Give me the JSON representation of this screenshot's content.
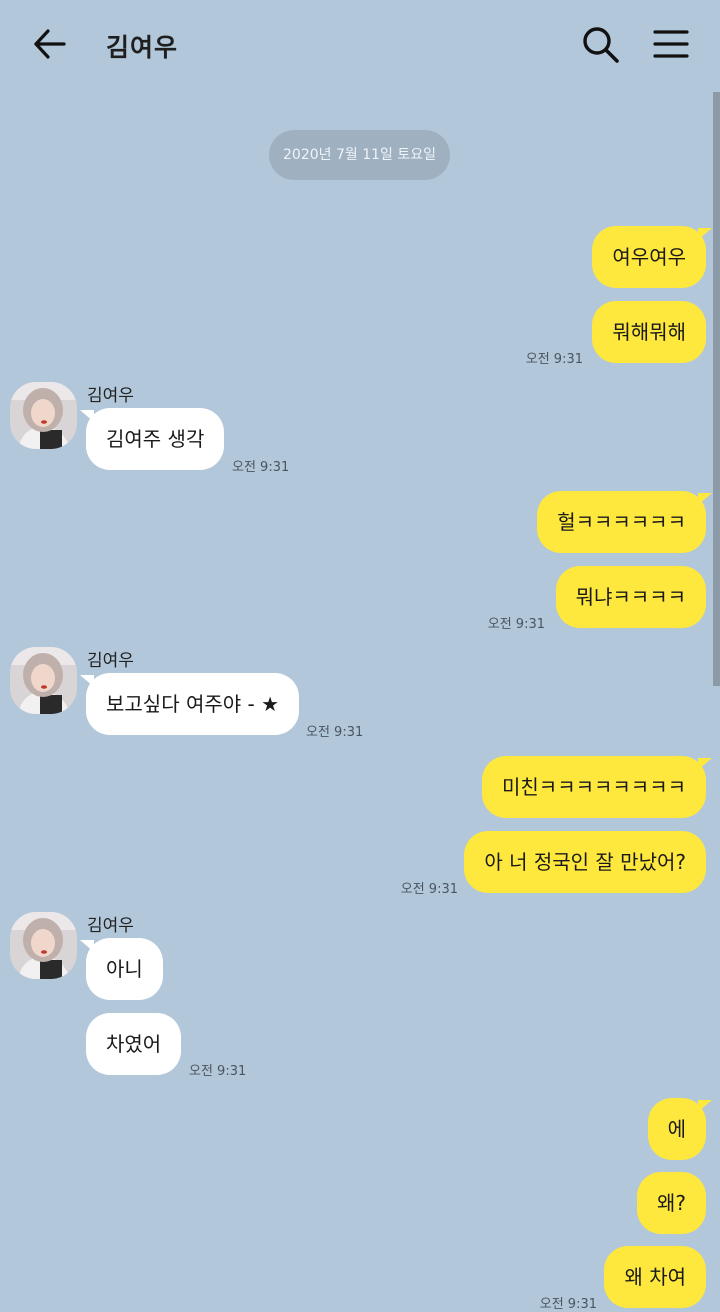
{
  "header": {
    "title": "김여우",
    "back_icon": "arrow-left-icon",
    "search_icon": "search-icon",
    "menu_icon": "hamburger-menu-icon"
  },
  "date_divider": "2020년 7월 11일 토요일",
  "messages": [
    {
      "side": "me",
      "text": "여우여우"
    },
    {
      "side": "me",
      "text": "뭐해뭐해",
      "time": "오전 9:31"
    },
    {
      "side": "them",
      "sender": "김여우",
      "text": "김여주 생각",
      "time": "오전 9:31"
    },
    {
      "side": "me",
      "text": "헐ㅋㅋㅋㅋㅋㅋ"
    },
    {
      "side": "me",
      "text": "뭐냐ㅋㅋㅋㅋ",
      "time": "오전 9:31"
    },
    {
      "side": "them",
      "sender": "김여우",
      "text": "보고싶다 여주야 - ★",
      "time": "오전 9:31"
    },
    {
      "side": "me",
      "text": "미친ㅋㅋㅋㅋㅋㅋㅋㅋ"
    },
    {
      "side": "me",
      "text": "아 너 정국인 잘 만났어?",
      "time": "오전 9:31"
    },
    {
      "side": "them",
      "sender": "김여우",
      "text": "아니"
    },
    {
      "side": "them",
      "text": "차였어",
      "time": "오전 9:31"
    },
    {
      "side": "me",
      "text": "에"
    },
    {
      "side": "me",
      "text": "왜?"
    },
    {
      "side": "me",
      "text": "왜 차여",
      "time": "오전 9:31"
    }
  ],
  "colors": {
    "background": "#b2c7da",
    "my_bubble": "#fee83d",
    "their_bubble": "#ffffff"
  }
}
